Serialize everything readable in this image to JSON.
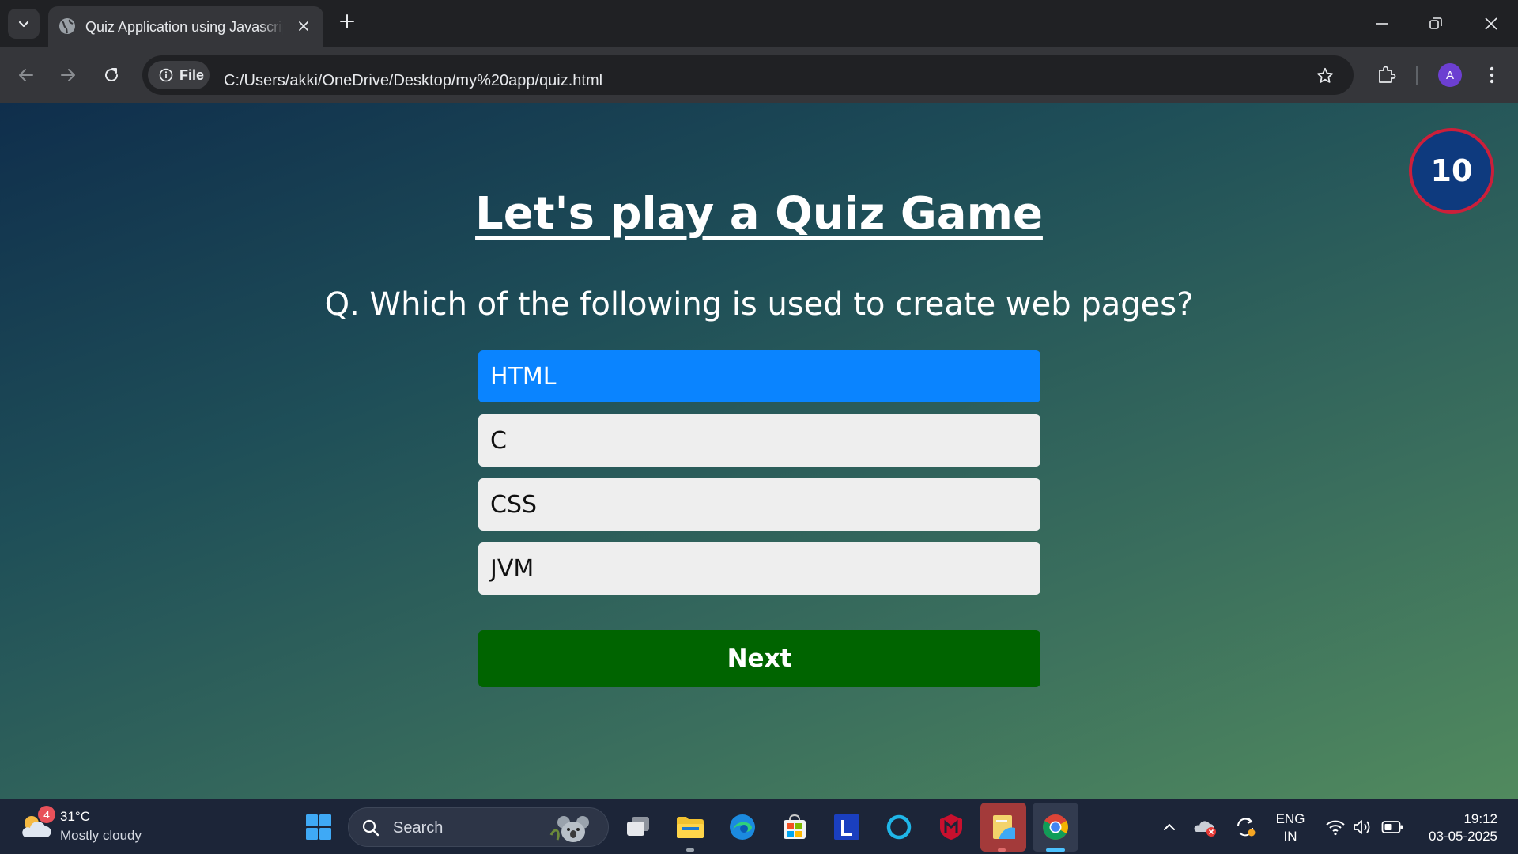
{
  "browser": {
    "tab_title": "Quiz Application using Javascript",
    "address": {
      "chip_label": "File",
      "url": "C:/Users/akki/OneDrive/Desktop/my%20app/quiz.html"
    },
    "profile_initial": "A"
  },
  "quiz": {
    "timer": "10",
    "heading": "Let's play a Quiz Game",
    "question": "Q. Which of the following is used to create web pages?",
    "answers": [
      "HTML",
      "C",
      "CSS",
      "JVM"
    ],
    "selected_answer": "HTML",
    "next_label": "Next"
  },
  "taskbar": {
    "weather": {
      "temp": "31°C",
      "desc": "Mostly cloudy",
      "badge": "4"
    },
    "search_label": "Search",
    "language": {
      "line1": "ENG",
      "line2": "IN"
    },
    "clock": {
      "time": "19:12",
      "date": "03-05-2025"
    }
  },
  "colors": {
    "selected_answer": "#0a84ff",
    "next_button": "#006400",
    "timer_fill": "#0e3a7e",
    "timer_ring": "#cc1f3a"
  },
  "icons": [
    "tab-search-icon",
    "globe-icon",
    "close-icon",
    "plus-icon",
    "minimize-icon",
    "restore-icon",
    "back-icon",
    "forward-icon",
    "reload-icon",
    "info-icon",
    "star-icon",
    "extensions-icon",
    "more-icon",
    "weather-icon",
    "windows-start-icon",
    "search-icon",
    "task-view-icon",
    "file-explorer-icon",
    "edge-icon",
    "store-icon",
    "l-app-icon",
    "circle-app-icon",
    "mcafee-icon",
    "notes-app-icon",
    "chrome-icon",
    "chevron-up-icon",
    "onedrive-icon",
    "sync-icon",
    "wifi-icon",
    "volume-icon",
    "battery-icon"
  ]
}
